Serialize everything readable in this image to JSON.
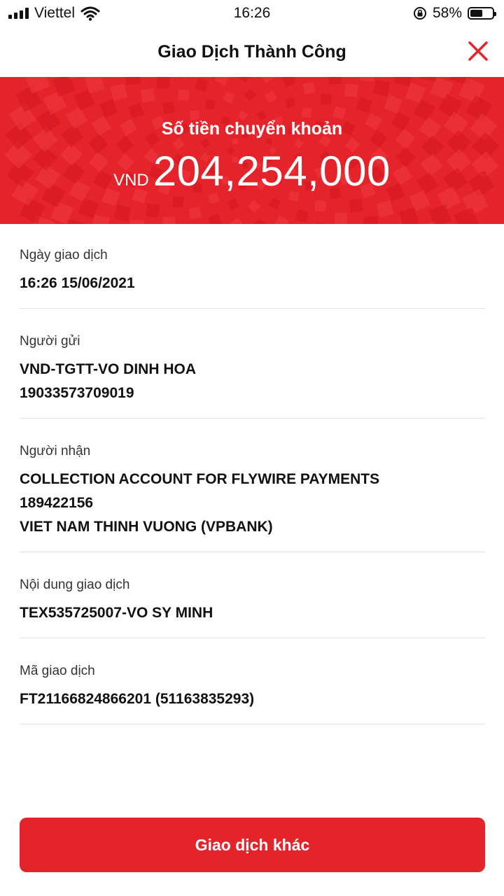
{
  "status_bar": {
    "carrier": "Viettel",
    "time": "16:26",
    "battery_percent": "58%",
    "battery_level": 0.58,
    "icons": [
      "signal-icon",
      "wifi-icon",
      "orientation-lock-icon",
      "battery-icon"
    ]
  },
  "header": {
    "title": "Giao Dịch Thành Công",
    "close_icon": "close-icon"
  },
  "banner": {
    "label": "Số tiền chuyển khoản",
    "currency": "VND",
    "amount": "204,254,000"
  },
  "details": [
    {
      "label": "Ngày giao dịch",
      "values": [
        "16:26 15/06/2021"
      ]
    },
    {
      "label": "Người gửi",
      "values": [
        "VND-TGTT-VO DINH HOA",
        "19033573709019"
      ]
    },
    {
      "label": "Người nhận",
      "values": [
        "COLLECTION ACCOUNT FOR FLYWIRE PAYMENTS",
        "189422156",
        "VIET NAM THINH VUONG (VPBANK)"
      ]
    },
    {
      "label": "Nội dung giao dịch",
      "values": [
        "TEX535725007-VO SY MINH"
      ]
    },
    {
      "label": "Mã giao dịch",
      "values": [
        "FT21166824866201 (51163835293)"
      ]
    }
  ],
  "actions": {
    "primary_label": "Giao dịch khác"
  },
  "colors": {
    "brand_red": "#e5232b",
    "text": "#111111",
    "divider": "#e3e3e3"
  }
}
